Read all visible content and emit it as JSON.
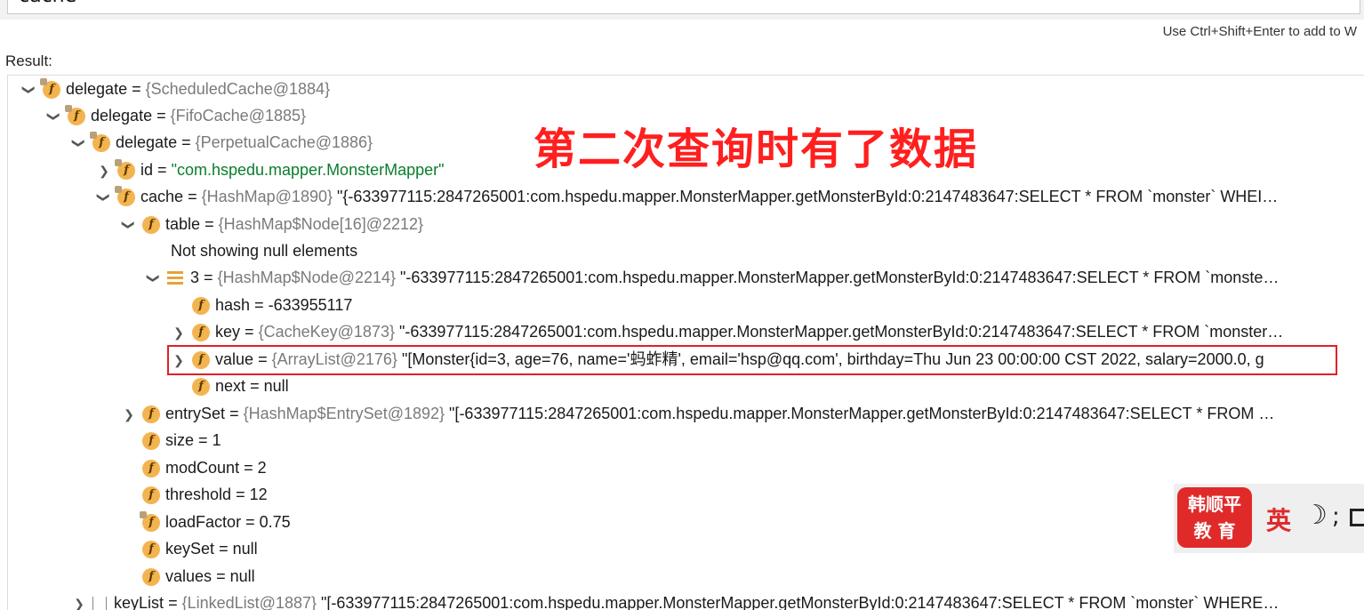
{
  "expression": {
    "value": "cache"
  },
  "hint": "Use Ctrl+Shift+Enter to add to W",
  "result_label": "Result:",
  "overlay_caption": "第二次查询时有了数据",
  "rows": [
    {
      "name": "delegate",
      "type": "{ScheduledCache@1884}",
      "value": ""
    },
    {
      "name": "delegate",
      "type": "{FifoCache@1885}",
      "value": ""
    },
    {
      "name": "delegate",
      "type": "{PerpetualCache@1886}",
      "value": ""
    },
    {
      "name": "id",
      "type": "",
      "value": "\"com.hspedu.mapper.MonsterMapper\""
    },
    {
      "name": "cache",
      "type": "{HashMap@1890}",
      "value": "\"{-633977115:2847265001:com.hspedu.mapper.MonsterMapper.getMonsterById:0:2147483647:SELECT * FROM `monster` WHEI…"
    },
    {
      "name": "table",
      "type": "{HashMap$Node[16]@2212}",
      "value": ""
    },
    {
      "name": "",
      "type": "",
      "value": "Not showing null elements"
    },
    {
      "name": "3",
      "type": "{HashMap$Node@2214}",
      "value": "\"-633977115:2847265001:com.hspedu.mapper.MonsterMapper.getMonsterById:0:2147483647:SELECT * FROM `monste…"
    },
    {
      "name": "hash",
      "type": "",
      "value": "-633955117"
    },
    {
      "name": "key",
      "type": "{CacheKey@1873}",
      "value": "\"-633977115:2847265001:com.hspedu.mapper.MonsterMapper.getMonsterById:0:2147483647:SELECT * FROM `monster…"
    },
    {
      "name": "value",
      "type": "{ArrayList@2176}",
      "value": "\"[Monster{id=3, age=76, name='蚂蚱精', email='hsp@qq.com', birthday=Thu Jun 23 00:00:00 CST 2022, salary=2000.0, g"
    },
    {
      "name": "next",
      "type": "",
      "value": "null"
    },
    {
      "name": "entrySet",
      "type": "{HashMap$EntrySet@1892}",
      "value": "\"[-633977115:2847265001:com.hspedu.mapper.MonsterMapper.getMonsterById:0:2147483647:SELECT * FROM …"
    },
    {
      "name": "size",
      "type": "",
      "value": "1"
    },
    {
      "name": "modCount",
      "type": "",
      "value": "2"
    },
    {
      "name": "threshold",
      "type": "",
      "value": "12"
    },
    {
      "name": "loadFactor",
      "type": "",
      "value": "0.75"
    },
    {
      "name": "keySet",
      "type": "",
      "value": "null"
    },
    {
      "name": "values",
      "type": "",
      "value": "null"
    },
    {
      "name": "keyList",
      "type": "{LinkedList@1887}",
      "value": "\"[-633977115:2847265001:com.hspedu.mapper.MonsterMapper.getMonsterById:0:2147483647:SELECT * FROM `monster` WHERE…"
    }
  ],
  "watermark": {
    "line1": "韩顺平",
    "line2": "教 育",
    "ime": "英",
    "moon": "☽",
    "semicolon": ";"
  },
  "colors": {
    "highlight": "#e0202a",
    "caption": "#ff1f1f",
    "string": "#0a7d2c",
    "type": "#7a7a7a",
    "field_icon": "#f3b450"
  }
}
